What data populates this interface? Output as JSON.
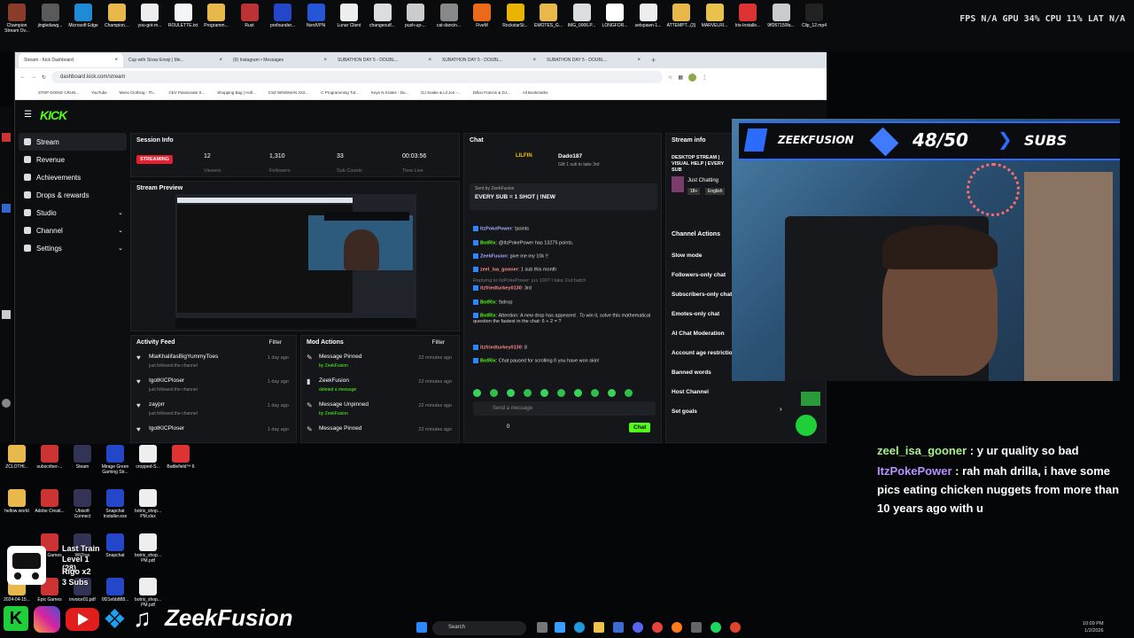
{
  "perf": {
    "fps_label": "FPS",
    "fps": "N/A",
    "gpu_label": "GPU",
    "gpu": "34",
    "cpu_label": "CPU",
    "cpu": "11",
    "lat_label": "LAT",
    "lat": "N/A"
  },
  "desktop_top": [
    "Champion Stream Ov...",
    "jingledawg...",
    "Microsoft Edge",
    "Champion...",
    "you-got-m...",
    "ROULETTE.txt",
    "Programm...",
    "Rust",
    "profounder...",
    "NordVPN",
    "Lunar Client",
    "changeoutf...",
    "push-up-...",
    "cat-dancin...",
    "FiveM",
    "RockstarSt...",
    "EMOTES_G...",
    "IMG_0006.P...",
    "LONGFOR...",
    "setspawn-1...",
    "ATTEMPT...(3)",
    "MARVELRI...",
    "Iris-Installe...",
    "9ff267150fa...",
    "Clip_12.mp4"
  ],
  "desktop_bottom": [
    [
      "ZCLOTHI...",
      "subscriber-...",
      "Steam",
      "Mirage Green Gaming Str...",
      "cropped-S...",
      "Battlefield™ 6"
    ],
    [
      "hellow world",
      "Adobe Creati...",
      "Ubisoft Connect",
      "Snapchat Installer.exe",
      "botrix_shop... PM.xlsx"
    ],
    [
      "",
      "Epic Games",
      "WiiTres",
      "Snapchat",
      "botrix_shop... PM.pdf"
    ],
    [
      "2024-04-15...",
      "Epic Games",
      "invoice01.pdf",
      "0f21ebb888...",
      "botrix_shop... PM.pdf"
    ]
  ],
  "browser": {
    "tabs": [
      "Stream - Kick Dashboard",
      "Cup with Straw Emoji | Me...",
      "(9) Instagram • Messages",
      "SUBATHON DAY 5 - DOUBL...",
      "SUBATHON DAY 5 - DOUBL...",
      "SUBATHON DAY 5 - DOUBL..."
    ],
    "url": "dashboard.kick.com/stream",
    "bookmarks": [
      "STOP DOING CRUN...",
      "YouTube",
      "Mens Clothing - Th...",
      "CEV Passionate S...",
      "Shopping Bag | Holl...",
      "CSZ WINGMAN 2X2...",
      "C Programming Tut...",
      "Keys N Krates - Du...",
      "DJ Snake & Lil Jon -...",
      "Dillon Francis & DJ...",
      "All Bookmarks"
    ]
  },
  "kick": {
    "logo": "KICK",
    "sidebar": [
      "Stream",
      "Revenue",
      "Achievements",
      "Drops & rewards",
      "Studio",
      "Channel",
      "Settings"
    ],
    "session": {
      "title": "Session Info",
      "status": "STREAMING",
      "viewers": "12",
      "viewers_label": "Viewers",
      "followers": "1,310",
      "followers_label": "Followers",
      "subs": "33",
      "subs_label": "Sub Counts",
      "time": "00:03:56",
      "time_label": "Time Live"
    },
    "preview_title": "Stream Preview",
    "activity": {
      "title": "Activity Feed",
      "filter": "Filter",
      "rows": [
        {
          "name": "MiaKhalifasBigYummyToes",
          "sub": "just followed the channel",
          "time": "1 day ago"
        },
        {
          "name": "IgotKICPloser",
          "sub": "just followed the channel",
          "time": "1 day ago"
        },
        {
          "name": "zayprr",
          "sub": "just followed the channel",
          "time": "1 day ago"
        },
        {
          "name": "IgotKICPloser",
          "sub": "",
          "time": "1 day ago"
        }
      ]
    },
    "mod": {
      "title": "Mod Actions",
      "filter": "Filter",
      "rows": [
        {
          "name": "Message Pinned",
          "sub": "by ZeekFusion",
          "time": "22 minutes ago"
        },
        {
          "name": "ZeekFusion",
          "sub": "deleted a message",
          "time": "22 minutes ago"
        },
        {
          "name": "Message Unpinned",
          "sub": "by ZeekFusion",
          "time": "22 minutes ago"
        },
        {
          "name": "Message Pinned",
          "sub": "",
          "time": "22 minutes ago"
        }
      ]
    },
    "chat": {
      "title": "Chat",
      "top_user": "LILFIN",
      "top_gifter": "Dado187",
      "gift_text": "Gift 1 sub to take 3rd",
      "pinned_by": "Sent by ZeekFusion",
      "pinned": "EVERY SUB = 1 SHOT | !NEW",
      "lines": [
        {
          "user": "ItzPokePower",
          "msg": ": !points",
          "cls": "cp"
        },
        {
          "user": "BotRix",
          "msg": ": @ItzPokePower has 13275 points.",
          "cls": "cu"
        },
        {
          "user": "ZeekFusion",
          "msg": ": give me my 10k !!",
          "cls": "cp"
        },
        {
          "user": "zeel_isa_gooner",
          "msg": ": 1 sub this month",
          "cls": "ca"
        },
        {
          "user": "Replying to ItzPokePower: jus 100? I take 2nd batch",
          "msg": "",
          "cls": ""
        },
        {
          "user": "itzfriedturkey0130",
          "msg": ": 3rd",
          "cls": "ca"
        },
        {
          "user": "BotRix",
          "msg": ": !bdrop",
          "cls": "cu"
        },
        {
          "user": "BotRix",
          "msg": ": Attention: A new drop has appeared . To win it, solve this mathematical question the fastest in the chat: 6 + 2 = ?",
          "cls": "cu"
        },
        {
          "user": "itzfriedturkey0130",
          "msg": ": 8",
          "cls": "ca"
        },
        {
          "user": "BotRix",
          "msg": ": Chat paused for scrolling  0 you have won skin!",
          "cls": "cu"
        }
      ],
      "placeholder": "Send a message",
      "chat_btn": "Chat",
      "count": "0"
    },
    "info": {
      "title": "Stream info",
      "stream_title": "DESKTOP STREAM | VISUAL HELP | EVERY SUB",
      "category": "Just Chatting",
      "tags": [
        "18+",
        "English"
      ]
    },
    "actions": {
      "title": "Channel Actions",
      "items": [
        "Slow mode",
        "Followers-only chat",
        "Subscribers-only chat",
        "Emotes-only chat",
        "AI Chat Moderation",
        "Account age restriction",
        "Banned words",
        "Host Channel",
        "Set goals"
      ]
    }
  },
  "overlay": {
    "channel": "ZEEKFUSION",
    "goal": "48/50",
    "goal_label": "SUBS",
    "chat": [
      {
        "user": "zeel_isa_gooner",
        "msg": " : y ur quality so bad"
      },
      {
        "user": "ItzPokePower",
        "msg": " : rah mah drilla, i have some pics eating chicken nuggets from more than 10 years ago with u"
      }
    ],
    "train": {
      "line1": "Last Train",
      "line2": "Level 1 (28)",
      "line3": "Rigo x2",
      "line4": "3 Subs"
    },
    "brand": "ZeekFusion"
  },
  "taskbar": {
    "search": "Search",
    "time": "10:09 PM",
    "date": "1/2/2026"
  }
}
